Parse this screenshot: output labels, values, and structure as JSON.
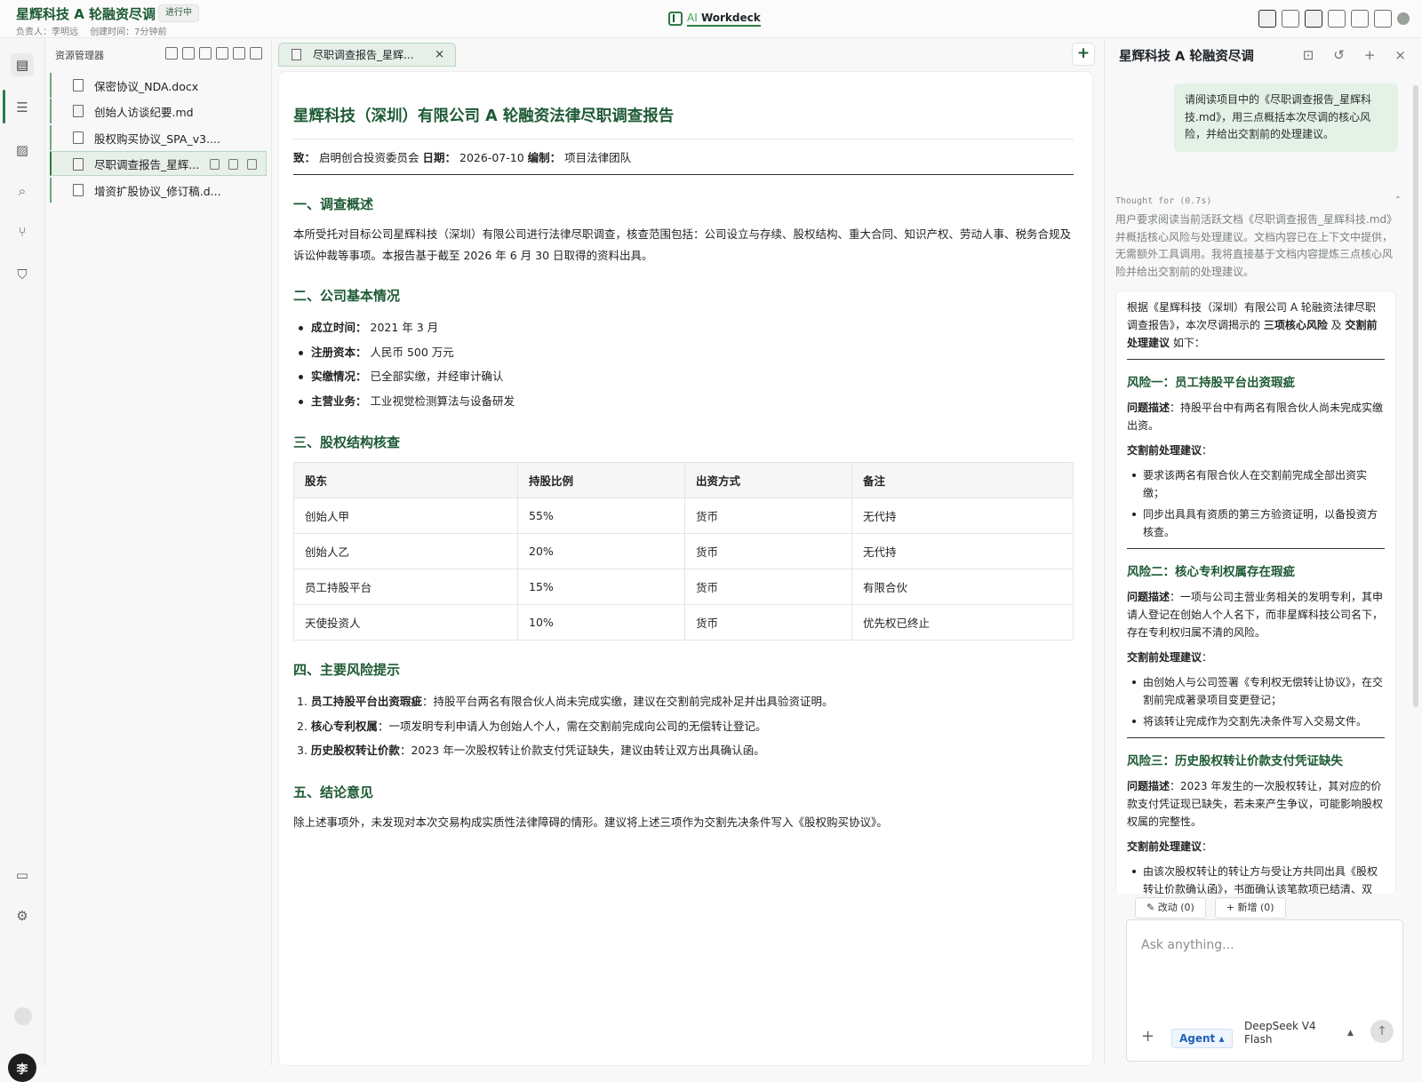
{
  "project": {
    "title": "星辉科技 A 轮融资尽调",
    "status": "进行中",
    "owner": "负责人：李明远",
    "created": "创建时间：7分钟前"
  },
  "logo": {
    "ai": "AI",
    "name": "Workdeck"
  },
  "explorer": {
    "title": "资源管理器",
    "files": [
      {
        "name": "保密协议_NDA.docx",
        "kind": "docx"
      },
      {
        "name": "创始人访谈纪要.md",
        "kind": "md"
      },
      {
        "name": "股权购买协议_SPA_v3....",
        "kind": "docx"
      },
      {
        "name": "尽职调查报告_星辉...",
        "kind": "md"
      },
      {
        "name": "增资扩股协议_修订稿.d...",
        "kind": "docx"
      }
    ]
  },
  "tab": {
    "label": "尽职调查报告_星辉...",
    "close": "×"
  },
  "new_tab": "+",
  "doc": {
    "title": "星辉科技（深圳）有限公司 A 轮融资法律尽职调查报告",
    "meta": {
      "to_label": "致：",
      "to": "启明创合投资委员会",
      "date_label": "日期：",
      "date": "2026-07-10",
      "author_label": "编制：",
      "author": "项目法律团队"
    },
    "s1": {
      "heading": "一、调查概述",
      "text": "本所受托对目标公司星辉科技（深圳）有限公司进行法律尽职调查，核查范围包括：公司设立与存续、股权结构、重大合同、知识产权、劳动人事、税务合规及诉讼仲裁等事项。本报告基于截至 2026 年 6 月 30 日取得的资料出具。"
    },
    "s2": {
      "heading": "二、公司基本情况",
      "items": [
        {
          "k": "成立时间：",
          "v": "2021 年 3 月"
        },
        {
          "k": "注册资本：",
          "v": "人民币 500 万元"
        },
        {
          "k": "实缴情况：",
          "v": "已全部实缴，并经审计确认"
        },
        {
          "k": "主营业务：",
          "v": "工业视觉检测算法与设备研发"
        }
      ]
    },
    "s3": {
      "heading": "三、股权结构核查",
      "columns": [
        "股东",
        "持股比例",
        "出资方式",
        "备注"
      ],
      "rows": [
        [
          "创始人甲",
          "55%",
          "货币",
          "无代持"
        ],
        [
          "创始人乙",
          "20%",
          "货币",
          "无代持"
        ],
        [
          "员工持股平台",
          "15%",
          "货币",
          "有限合伙"
        ],
        [
          "天使投资人",
          "10%",
          "货币",
          "优先权已终止"
        ]
      ]
    },
    "s4": {
      "heading": "四、主要风险提示",
      "items": [
        {
          "n": "1.",
          "k": "员工持股平台出资瑕疵",
          "v": "：持股平台两名有限合伙人尚未完成实缴，建议在交割前完成补足并出具验资证明。"
        },
        {
          "n": "2.",
          "k": "核心专利权属",
          "v": "：一项发明专利申请人为创始人个人，需在交割前完成向公司的无偿转让登记。"
        },
        {
          "n": "3.",
          "k": "历史股权转让价款",
          "v": "：2023 年一次股权转让价款支付凭证缺失，建议由转让双方出具确认函。"
        }
      ]
    },
    "s5": {
      "heading": "五、结论意见",
      "text": "除上述事项外，未发现对本次交易构成实质性法律障碍的情形。建议将上述三项作为交割先决条件写入《股权购买协议》。"
    }
  },
  "chat": {
    "title": "星辉科技 A 轮融资尽调",
    "user_message": "请阅读项目中的《尽职调查报告_星辉科技.md》，用三点概括本次尽调的核心风险，并给出交割前的处理建议。",
    "thought_header": "Thought for (0.7s)",
    "thought": "用户要求阅读当前活跃文档《尽职调查报告_星辉科技.md》并概括核心风险与处理建议。文档内容已在上下文中提供，无需额外工具调用。我将直接基于文档内容提炼三点核心风险并给出交割前的处理建议。",
    "answer": {
      "intro_a": "根据《星辉科技（深圳）有限公司 A 轮融资法律尽职调查报告》，本次尽调揭示的 ",
      "intro_b1": "三项核心风险",
      "intro_c": " 及 ",
      "intro_b2": "交割前处理建议",
      "intro_d": " 如下：",
      "desc_label": "问题描述",
      "advice_label": "交割前处理建议",
      "risks": [
        {
          "title": "风险一：员工持股平台出资瑕疵",
          "desc": "：持股平台中有两名有限合伙人尚未完成实缴出资。",
          "advice": [
            "要求该两名有限合伙人在交割前完成全部出资实缴；",
            "同步出具具有资质的第三方验资证明，以备投资方核查。"
          ]
        },
        {
          "title": "风险二：核心专利权属存在瑕疵",
          "desc": "：一项与公司主营业务相关的发明专利，其申请人登记在创始人个人名下，而非星辉科技公司名下，存在专利权归属不清的风险。",
          "advice": [
            "由创始人与公司签署《专利权无偿转让协议》，在交割前完成著录项目变更登记；",
            "将该转让完成作为交割先决条件写入交易文件。"
          ]
        },
        {
          "title": "风险三：历史股权转让价款支付凭证缺失",
          "desc": "：2023 年发生的一次股权转让，其对应的价款支付凭证现已缺失，若未来产生争议，可能影响股权权属的完整性。",
          "advice": [
            "由该次股权转让的转让方与受让方共同出具《股权转让价款确认函》，书面确认该笔款项已结清、双"
          ]
        }
      ]
    },
    "chips": {
      "modify": "改动 (0)",
      "add": "新增 (0)"
    },
    "input_placeholder": "Ask anything...",
    "agent": "Agent",
    "model": "DeepSeek V4 Flash"
  }
}
